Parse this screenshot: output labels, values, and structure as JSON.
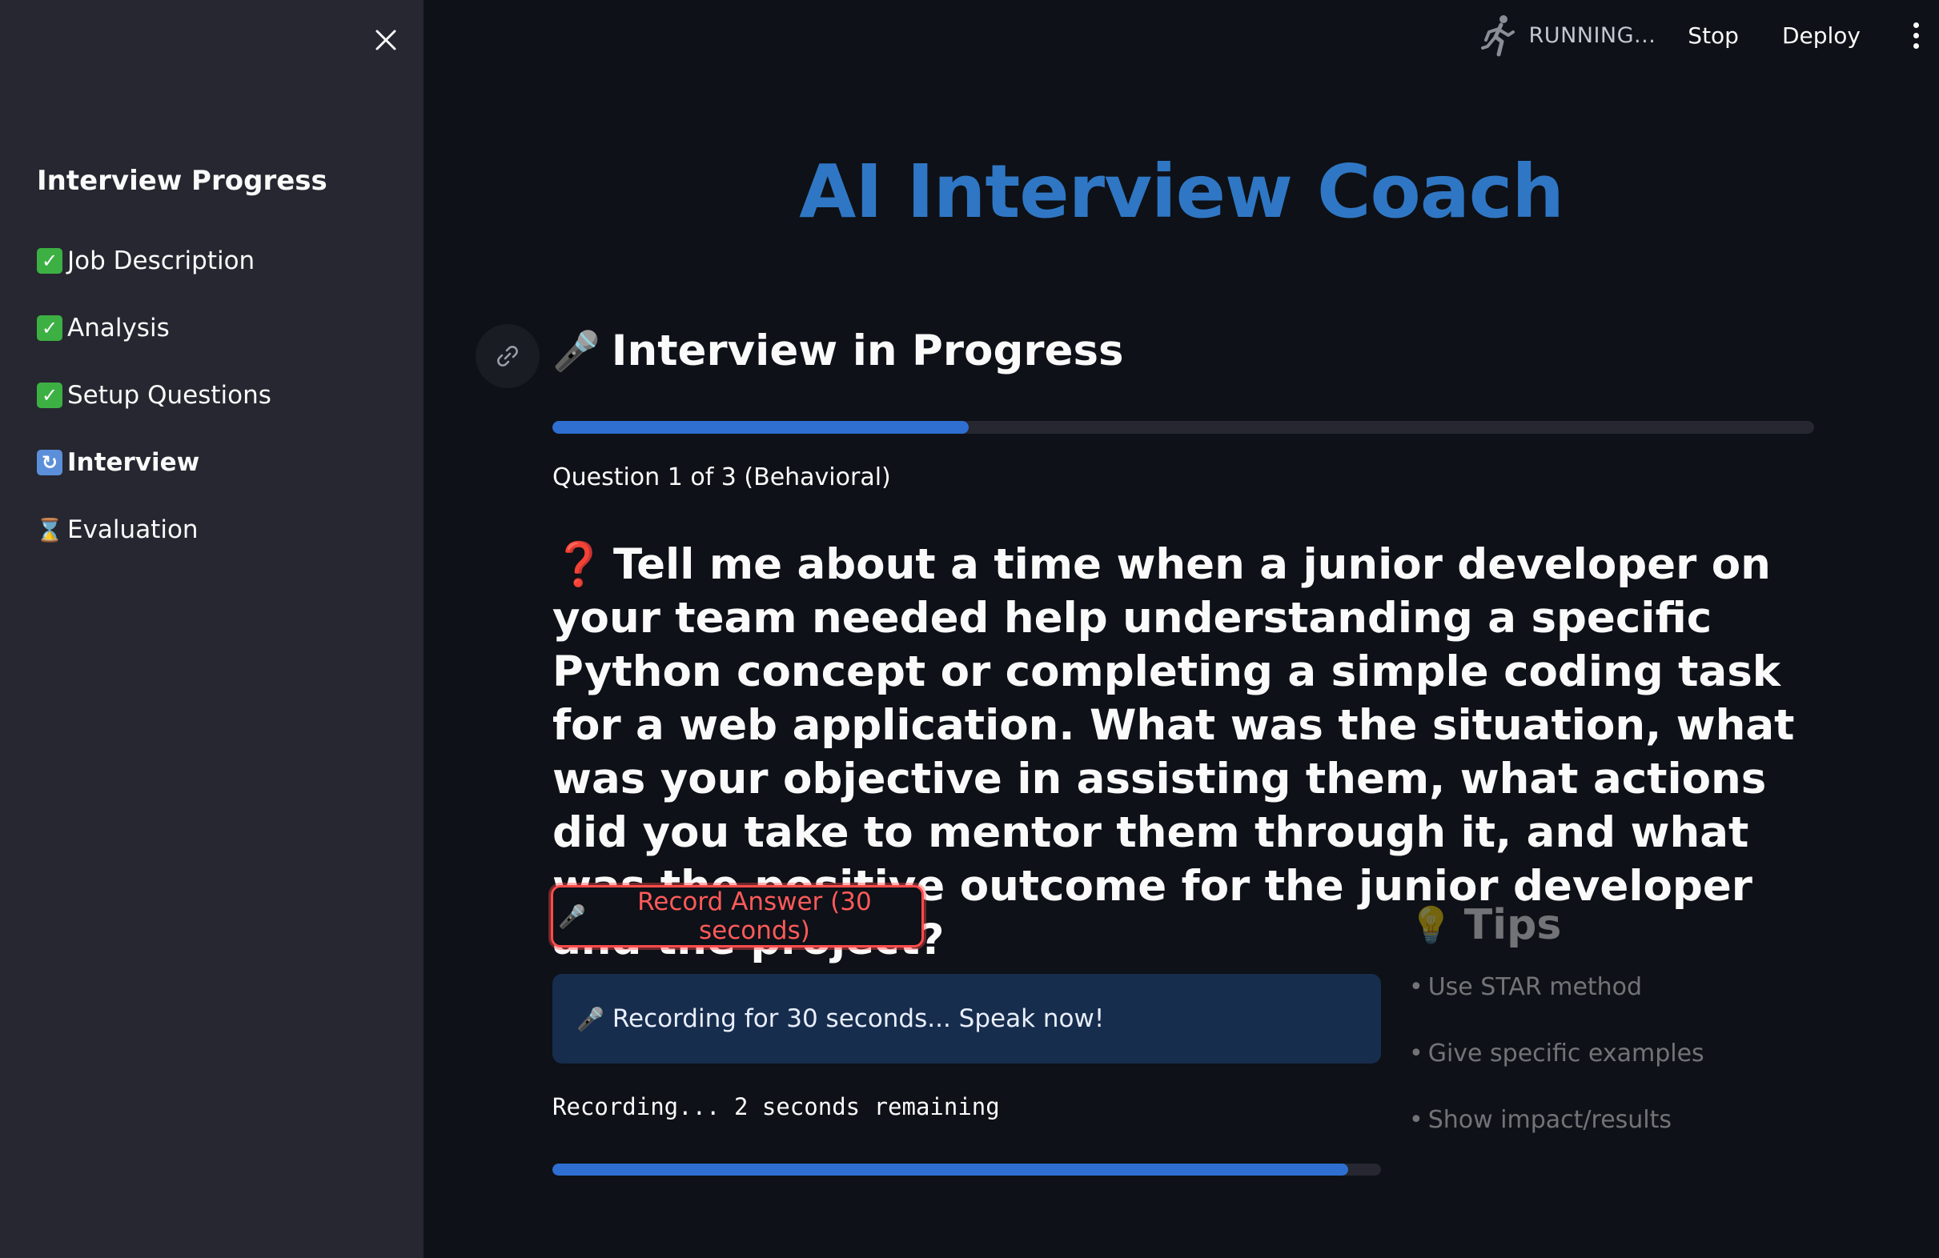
{
  "sidebar": {
    "heading": "Interview Progress",
    "items": [
      {
        "icon": "check-icon",
        "label": "Job Description",
        "status": "done"
      },
      {
        "icon": "check-icon",
        "label": "Analysis",
        "status": "done"
      },
      {
        "icon": "check-icon",
        "label": "Setup Questions",
        "status": "done"
      },
      {
        "icon": "cycle-icon",
        "label": "Interview",
        "status": "current"
      },
      {
        "icon": "hourglass-icon",
        "label": "Evaluation",
        "status": "pending"
      }
    ]
  },
  "toolbar": {
    "status": "RUNNING...",
    "stop_label": "Stop",
    "deploy_label": "Deploy"
  },
  "main": {
    "title": "AI Interview Coach",
    "section_title": "Interview in Progress",
    "interview_progress": 0.33,
    "question_counter": "Question 1 of 3 (Behavioral)",
    "question": "Tell me about a time when a junior developer on your team needed help understanding a specific Python concept or completing a simple coding task for a web application. What was the situation, what was your objective in assisting them, what actions did you take to mentor them through it, and what was the positive outcome for the junior developer and the project?",
    "record_button": "Record Answer (30 seconds)",
    "info_message": "Recording for 30 seconds... Speak now!",
    "countdown": "Recording... 2 seconds remaining",
    "recording_progress": 0.96
  },
  "tips": {
    "title": "Tips",
    "items": [
      "Use STAR method",
      "Give specific examples",
      "Show impact/results"
    ]
  },
  "colors": {
    "background": "#0e1117",
    "sidebar": "#262730",
    "title": "#2f77c4",
    "progress": "#2e6fd1",
    "record_button": "#ff4b4b",
    "info_box": "#172d4d"
  }
}
